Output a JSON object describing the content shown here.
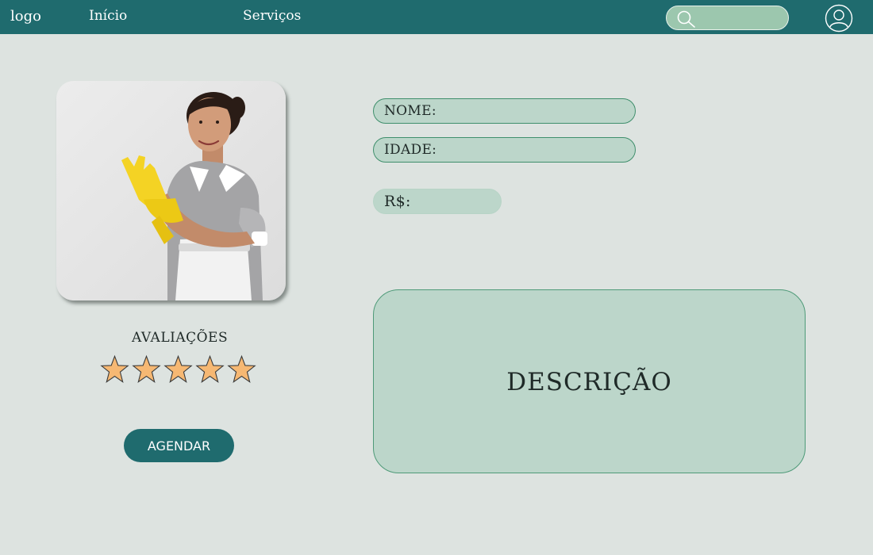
{
  "header": {
    "logo": "logo",
    "nav": {
      "inicio": "Início",
      "servicos": "Serviços"
    },
    "search": {
      "placeholder": "",
      "icon": "search-icon"
    },
    "user_icon": "user-icon",
    "colors": {
      "bar": "#1f6b6e",
      "search_bg": "#9cc7ae"
    }
  },
  "profile": {
    "photo_alt": "Profissional de limpeza",
    "ratings_title": "AVALIAÇÕES",
    "stars": {
      "filled": 5,
      "total": 5,
      "color": "#f6b873"
    },
    "schedule_button": "AGENDAR"
  },
  "details": {
    "name_label": "NOME:",
    "age_label": "IDADE:",
    "price_label": "R$:",
    "description_label": "DESCRIÇÃO",
    "colors": {
      "field_bg": "#bcd6ca",
      "field_border": "#3f8f6c"
    }
  }
}
